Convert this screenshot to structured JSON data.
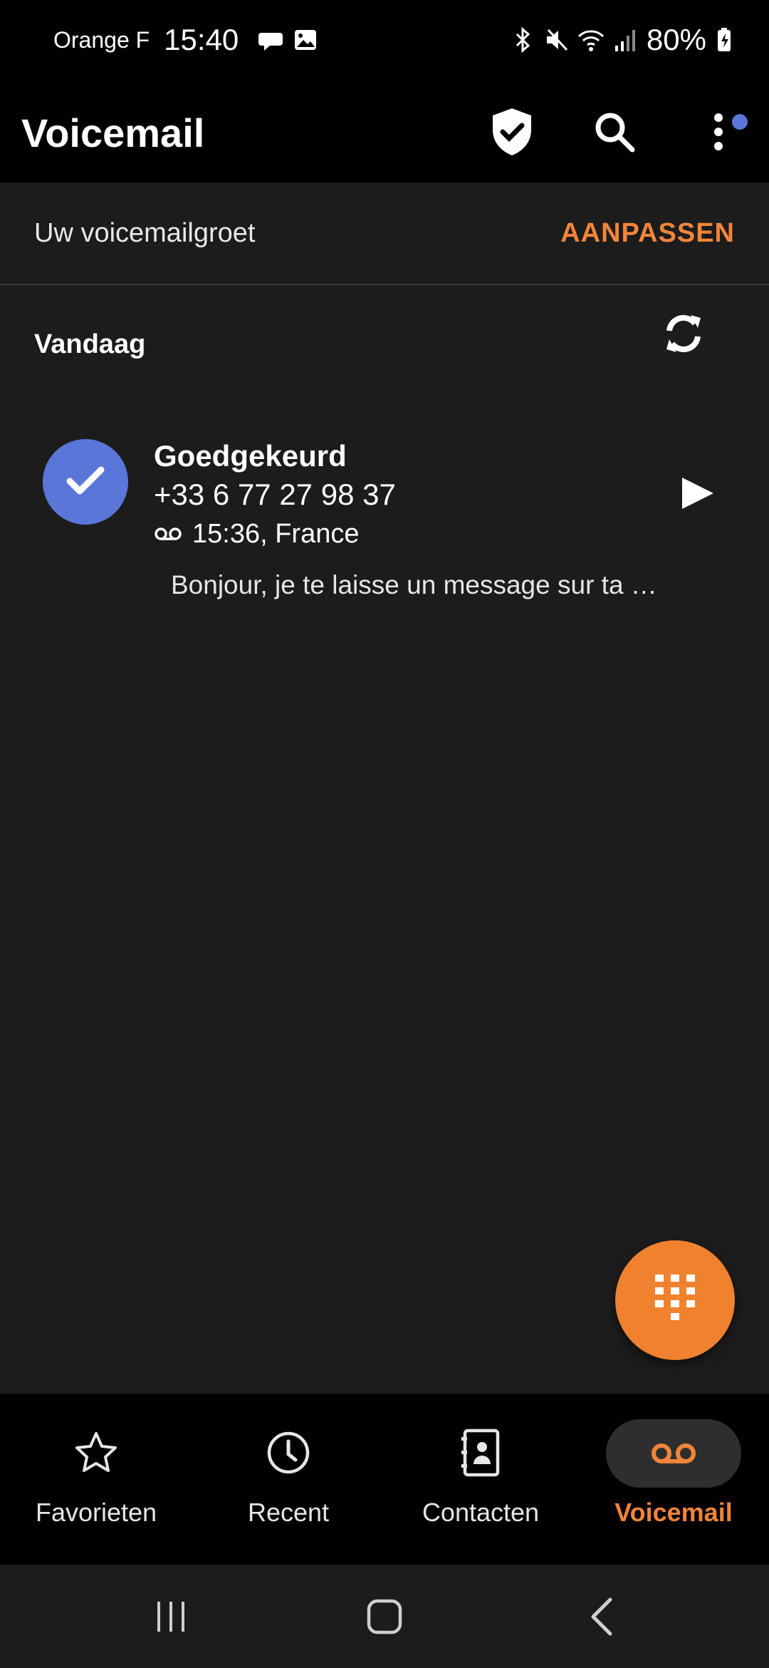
{
  "status_bar": {
    "carrier": "Orange F",
    "time": "15:40",
    "battery": "80%"
  },
  "app_bar": {
    "title": "Voicemail"
  },
  "greeting": {
    "label": "Uw voicemailgroet",
    "action": "AANPASSEN"
  },
  "section": {
    "title": "Vandaag"
  },
  "voicemails": [
    {
      "name": "Goedgekeurd",
      "number": "+33 6 77 27 98 37",
      "meta": "15:36, France",
      "snippet": "Bonjour, je te laisse un message sur ta …"
    }
  ],
  "bottom_nav": {
    "items": [
      {
        "label": "Favorieten",
        "icon": "star-icon"
      },
      {
        "label": "Recent",
        "icon": "clock-icon"
      },
      {
        "label": "Contacten",
        "icon": "contacts-icon"
      },
      {
        "label": "Voicemail",
        "icon": "voicemail-icon",
        "active": true
      }
    ]
  },
  "colors": {
    "accent": "#f2853a",
    "avatar": "#5a76d9",
    "background": "#1c1c1c"
  }
}
